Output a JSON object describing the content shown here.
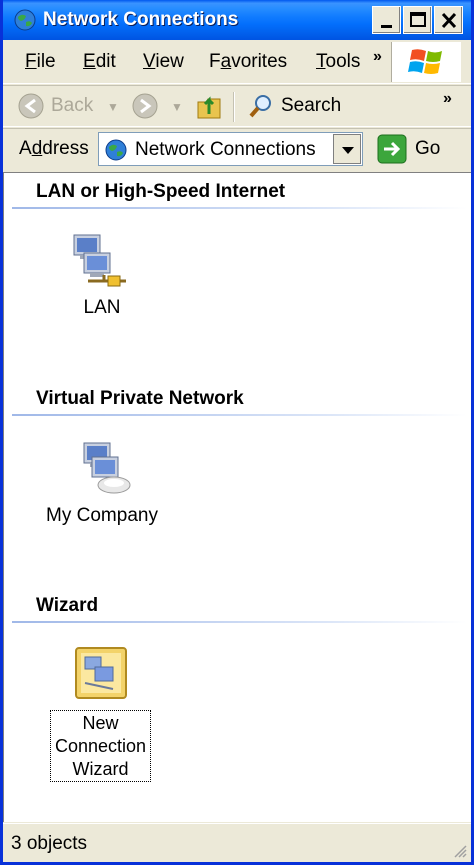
{
  "window": {
    "title": "Network Connections"
  },
  "menu": {
    "file": "ile",
    "file_key": "F",
    "edit": "dit",
    "edit_key": "E",
    "view": "iew",
    "view_key": "V",
    "favorites_pre": "F",
    "favorites_key": "a",
    "favorites_post": "vorites",
    "tools": "ools",
    "tools_key": "T",
    "more": "»"
  },
  "toolbar": {
    "back": "Back",
    "search": "Search",
    "more": "»"
  },
  "address": {
    "label_pre": "A",
    "label_key": "d",
    "label_post": "dress",
    "value": "Network Connections",
    "go": "Go"
  },
  "groups": [
    {
      "header": "LAN or High-Speed Internet",
      "items": [
        {
          "label": "LAN"
        }
      ]
    },
    {
      "header": "Virtual Private Network",
      "items": [
        {
          "label": "My Company"
        }
      ]
    },
    {
      "header": "Wizard",
      "items": [
        {
          "label_lines": [
            "New",
            "Connection",
            "Wizard"
          ]
        }
      ]
    }
  ],
  "status": {
    "text": "3 objects"
  },
  "colors": {
    "titlebar": "#0054e3",
    "window_bg": "#ece9d8",
    "content_bg": "#ffffff"
  }
}
